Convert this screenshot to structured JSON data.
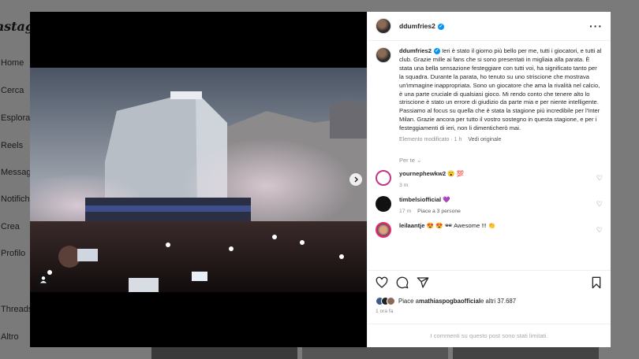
{
  "background": {
    "logo": "Instagram",
    "nav": [
      {
        "label": "Home"
      },
      {
        "label": "Cerca"
      },
      {
        "label": "Esplora"
      },
      {
        "label": "Reels"
      },
      {
        "label": "Messaggi"
      },
      {
        "label": "Notifiche"
      },
      {
        "label": "Crea"
      },
      {
        "label": "Profilo"
      },
      {
        "label": "Threads"
      },
      {
        "label": "Altro"
      }
    ]
  },
  "post": {
    "author": "ddumfries2",
    "caption_author": "ddumfries2",
    "caption": "Ieri è stato il giorno più bello per me, tutti i giocatori, e tutti al club. Grazie mille ai fans che si sono presentati in migliaia alla parata. È stata una bella sensazione festeggiare con tutti voi, ha significato tanto per la squadra. Durante la parata, ho tenuto su uno striscione che mostrava un'immagine inappropriata. Sono un giocatore che ama la rivalità nel calcio, è una parte cruciale di qualsiasi gioco. Mi rendo conto che tenere alto lo striscione è stato un errore di giudizio da parte mia e per niente intelligente. Passiamo al focus su quella che è stata la stagione più incredibile per l'Inter Milan. Grazie ancora per tutto il vostro sostegno in questa stagione, e per i festeggiamenti di ieri, non li dimenticherò mai.",
    "edited_label": "Elemento modificato · 1 h",
    "see_original": "Vedi originale",
    "for_you": "Per te",
    "comments": [
      {
        "user": "yournephewkw2",
        "text": "😮 💯",
        "time": "3 m",
        "likes": ""
      },
      {
        "user": "timbelsiofficial",
        "text": "💜",
        "time": "17 m",
        "likes": "Piace a 3 persone"
      },
      {
        "user": "leilaantje",
        "text": "😍 😍 🕶 Awesome !!! 👏",
        "time": "",
        "likes": ""
      }
    ],
    "likes_prefix": "Piace a ",
    "likes_user": "mathiaspogbaofficial",
    "likes_suffix": " e altri 37.687",
    "time": "1 ora fa",
    "limited_notice": "I commenti su questo post sono stati limitati."
  },
  "colors": {
    "verified": "#0095f6",
    "overlay": "#7a7a7a"
  }
}
